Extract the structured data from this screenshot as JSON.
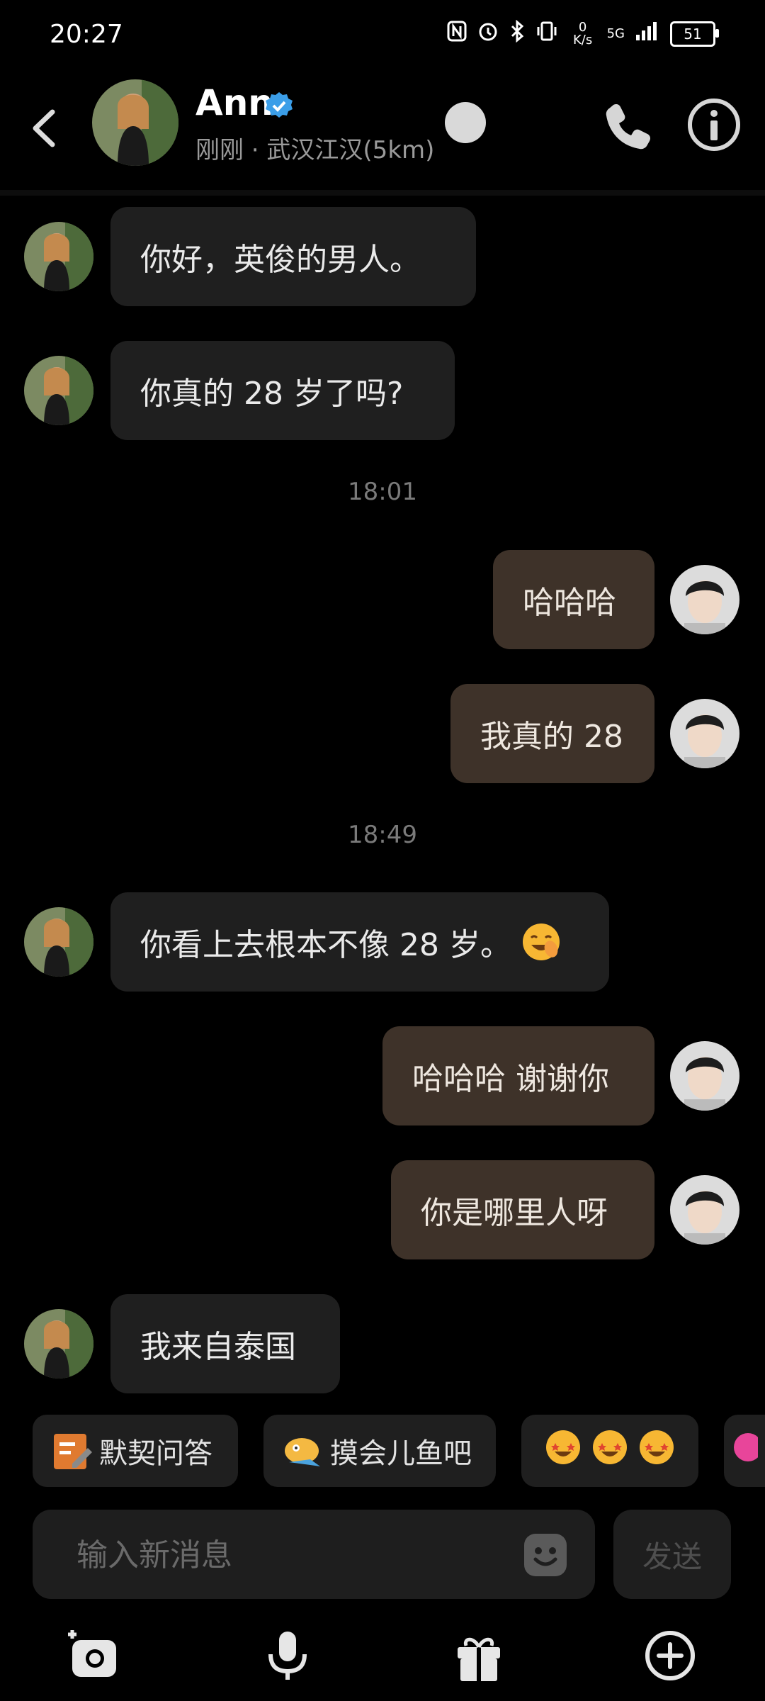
{
  "status_bar": {
    "time": "20:27",
    "net_speed": "0 K/s",
    "network": "5G",
    "battery": "51"
  },
  "header": {
    "name": "Ann",
    "subtitle": "刚刚 · 武汉江汉(5km)"
  },
  "messages": [
    {
      "from": "them",
      "text": "你好，英俊的男人。"
    },
    {
      "from": "them",
      "text": "你真的 28 岁了吗?"
    },
    {
      "type": "timestamp",
      "text": "18:01"
    },
    {
      "from": "me",
      "text": "哈哈哈"
    },
    {
      "from": "me",
      "text": "我真的 28"
    },
    {
      "type": "timestamp",
      "text": "18:49"
    },
    {
      "from": "them",
      "text": "你看上去根本不像 28 岁。",
      "emoji": "blush-laugh-emoji"
    },
    {
      "from": "me",
      "text": "哈哈哈 谢谢你"
    },
    {
      "from": "me",
      "text": "你是哪里人呀"
    },
    {
      "from": "them",
      "text": "我来自泰国"
    }
  ],
  "quick_replies": [
    {
      "label": "默契问答",
      "icon": "quiz-icon"
    },
    {
      "label": "摸会儿鱼吧",
      "icon": "fish-icon"
    },
    {
      "label": "",
      "icon": "star-struck-emoji-row"
    }
  ],
  "input": {
    "placeholder": "输入新消息",
    "value": ""
  },
  "send_label": "发送",
  "bottom_bar": [
    "camera-icon",
    "microphone-icon",
    "gift-icon",
    "plus-circle-icon"
  ],
  "colors": {
    "incoming_bubble": "#1f1f1f",
    "outgoing_bubble": "#3e3229",
    "verified": "#3b9ee8"
  }
}
